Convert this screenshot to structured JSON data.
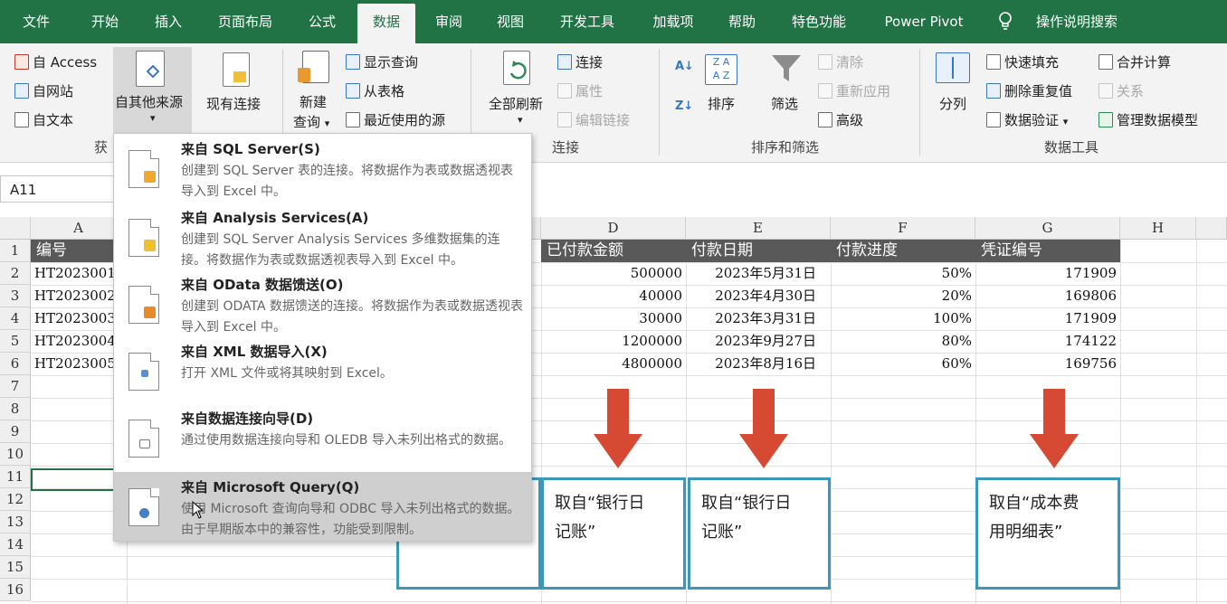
{
  "ribbon_tabs": [
    "文件",
    "开始",
    "插入",
    "页面布局",
    "公式",
    "数据",
    "审阅",
    "视图",
    "开发工具",
    "加载项",
    "帮助",
    "特色功能",
    "Power Pivot"
  ],
  "tell_me": "操作说明搜索",
  "ribbon": {
    "get_data": {
      "access": "自 Access",
      "web": "自网站",
      "text": "自文本",
      "other_sources": "自其他来源",
      "existing": "现有连接",
      "label_partial": "获"
    },
    "query": {
      "new_query": "新建",
      "new_query_2": "查询",
      "show_queries": "显示查询",
      "from_table": "从表格",
      "recent_sources": "最近使用的源"
    },
    "connections": {
      "refresh_all": "全部刷新",
      "connections": "连接",
      "properties": "属性",
      "edit_links": "编辑链接",
      "label": "连接"
    },
    "sort_filter": {
      "sort": "排序",
      "filter": "筛选",
      "clear": "清除",
      "reapply": "重新应用",
      "advanced": "高级",
      "label": "排序和筛选"
    },
    "data_tools": {
      "text_to_columns": "分列",
      "flash_fill": "快速填充",
      "remove_duplicates": "删除重复值",
      "data_validation": "数据验证",
      "consolidate": "合并计算",
      "relationships": "关系",
      "manage_model": "管理数据模型",
      "label": "数据工具"
    }
  },
  "name_box": "A11",
  "columns": [
    "A",
    "D",
    "E",
    "F",
    "G",
    "H"
  ],
  "rows": [
    "1",
    "2",
    "3",
    "4",
    "5",
    "6",
    "7",
    "8",
    "9",
    "10",
    "11",
    "12",
    "13",
    "14",
    "15",
    "16"
  ],
  "table": {
    "headers": {
      "A": "编号",
      "D": "已付款金额",
      "E": "付款日期",
      "F": "付款进度",
      "G": "凭证编号"
    },
    "rows": [
      {
        "A": "HT2023001",
        "D": "500000",
        "E": "2023年5月31日",
        "F": "50%",
        "G": "171909"
      },
      {
        "A": "HT2023002",
        "D": "40000",
        "E": "2023年4月30日",
        "F": "20%",
        "G": "169806"
      },
      {
        "A": "HT2023003",
        "D": "30000",
        "E": "2023年3月31日",
        "F": "100%",
        "G": "171909"
      },
      {
        "A": "HT2023004",
        "D": "1200000",
        "E": "2023年9月27日",
        "F": "80%",
        "G": "174122"
      },
      {
        "A": "HT2023005",
        "D": "4800000",
        "E": "2023年8月16日",
        "F": "60%",
        "G": "169756"
      }
    ]
  },
  "notes": [
    {
      "line1": "取自“银行日",
      "line2": "记账”"
    },
    {
      "line1": "取自“银行日",
      "line2": "记账”"
    },
    {
      "line1": "取自“成本费",
      "line2": "用明细表”"
    }
  ],
  "dropdown": {
    "items": [
      {
        "title": "来自 SQL Server(S)",
        "desc": "创建到 SQL Server 表的连接。将数据作为表或数据透视表导入到 Excel 中。",
        "icon": "database-icon",
        "color": "#f0a830"
      },
      {
        "title": "来自 Analysis Services(A)",
        "desc": "创建到 SQL Server Analysis Services 多维数据集的连接。将数据作为表或数据透视表导入到 Excel 中。",
        "icon": "cube-icon",
        "color": "#f0c030"
      },
      {
        "title": "来自 OData 数据馈送(O)",
        "desc": "创建到 ODATA 数据馈送的连接。将数据作为表或数据透视表导入到 Excel 中。",
        "icon": "feed-icon",
        "color": "#e88a2a"
      },
      {
        "title": "来自 XML 数据导入(X)",
        "desc": "打开 XML 文件或将其映射到 Excel。",
        "icon": "xml-icon",
        "color": "#5b8fd0"
      },
      {
        "title": "来自数据连接向导(D)",
        "desc": "通过使用数据连接向导和 OLEDB 导入未列出格式的数据。",
        "icon": "wizard-icon",
        "color": "#7a7a7a"
      },
      {
        "title": "来自 Microsoft Query(Q)",
        "desc": "使用 Microsoft 查询向导和 ODBC 导入未列出格式的数据。由于早期版本中的兼容性，功能受到限制。",
        "icon": "query-icon",
        "color": "#4a7fc0"
      }
    ]
  },
  "colors": {
    "brand": "#217346",
    "header_fill": "#595959",
    "arrow": "#d64933",
    "note_border": "#3b98b8"
  }
}
